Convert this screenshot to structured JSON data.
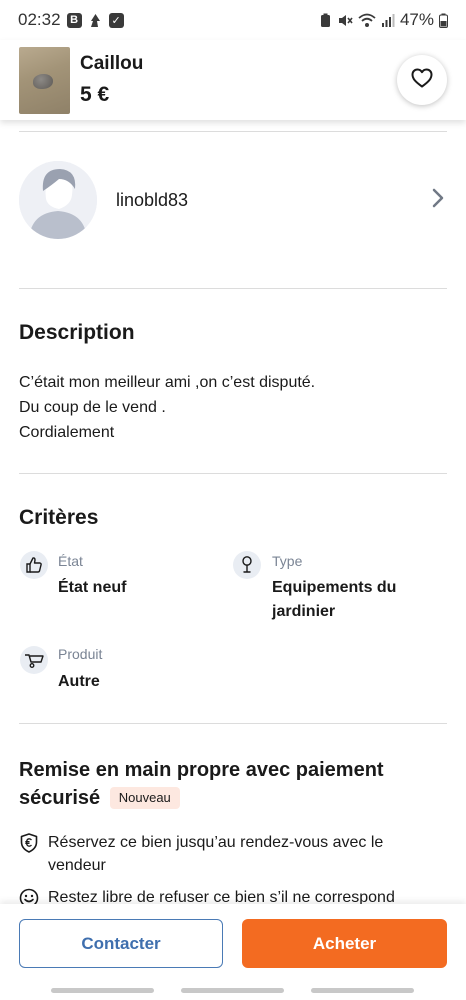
{
  "status_bar": {
    "time": "02:32",
    "battery": "47%"
  },
  "product": {
    "title": "Caillou",
    "price": "5 €",
    "favorite_icon": "heart-outline-icon"
  },
  "seller": {
    "name": "linobld83"
  },
  "description": {
    "heading": "Description",
    "lines": [
      "C’était mon meilleur ami ,on c’est disputé.",
      "Du coup de le vend .",
      "Cordialement"
    ]
  },
  "criteria": {
    "heading": "Critères",
    "items": [
      {
        "label": "État",
        "value": "État neuf",
        "icon": "thumbs-up-icon"
      },
      {
        "label": "Type",
        "value": "Equipements du jardinier",
        "value_line1": "Equipements du",
        "value_line2": "jardinier",
        "icon": "shovel-icon"
      },
      {
        "label": "Produit",
        "value": "Autre",
        "icon": "wheelbarrow-icon"
      }
    ]
  },
  "handoff": {
    "title_line1": "Remise en main propre avec paiement",
    "title_line2": "sécurisé",
    "badge": "Nouveau",
    "features": [
      {
        "text_line1": "Réservez ce bien jusqu’au rendez-vous avec le",
        "text_line2": "vendeur",
        "icon": "euro-shield-icon"
      },
      {
        "text_line1": "Restez libre de refuser ce bien s’il ne correspond",
        "icon": "smile-icon"
      }
    ]
  },
  "actions": {
    "contact_label": "Contacter",
    "buy_label": "Acheter"
  },
  "colors": {
    "accent_orange": "#f36b21",
    "accent_blue": "#3f6fae",
    "badge_bg": "#fde8e0"
  }
}
